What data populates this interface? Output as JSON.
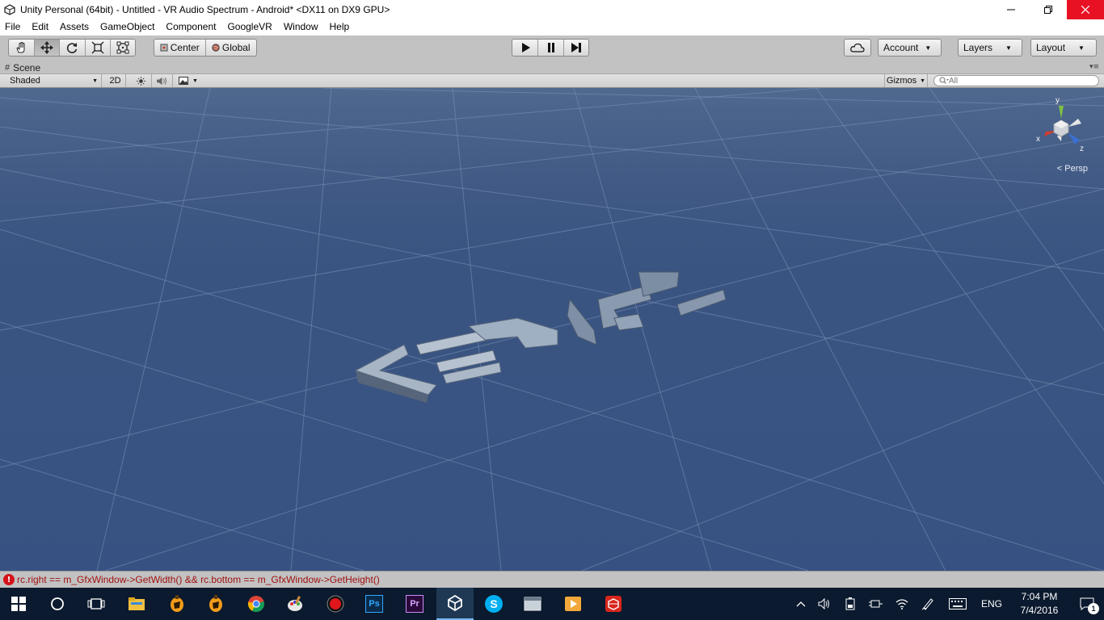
{
  "window": {
    "title": "Unity Personal (64bit) - Untitled - VR Audio Spectrum - Android* <DX11 on DX9 GPU>",
    "minimize_icon": "minimize-icon",
    "maximize_icon": "restore-icon",
    "close_icon": "close-icon"
  },
  "menubar": {
    "items": [
      "File",
      "Edit",
      "Assets",
      "GameObject",
      "Component",
      "GoogleVR",
      "Window",
      "Help"
    ]
  },
  "toolbar": {
    "transform_tools": [
      "hand-icon",
      "move-icon",
      "rotate-icon",
      "scale-icon",
      "rect-tool-icon"
    ],
    "active_tool": "move-icon",
    "pivot_center_label": "Center",
    "pivot_global_label": "Global",
    "play_icons": [
      "play-icon",
      "pause-icon",
      "step-icon"
    ],
    "cloud_icon": "cloud-icon",
    "account_label": "Account",
    "layers_label": "Layers",
    "layout_label": "Layout"
  },
  "scene_tab": {
    "label": "Scene",
    "hash": "#",
    "menu_icon": "tab-menu-icon"
  },
  "scene_controls": {
    "draw_mode": "Shaded",
    "mode_2d": "2D",
    "lighting_icon": "sun-icon",
    "audio_icon": "speaker-icon",
    "effects_icon": "image-icon",
    "gizmos_label": "Gizmos",
    "search_placeholder": "All"
  },
  "viewport": {
    "gizmo_axes": {
      "x": "x",
      "y": "y",
      "z": "z"
    },
    "projection_label": "Persp",
    "background_color": "#3b5582"
  },
  "status": {
    "error_icon": "error-icon",
    "message": "rc.right == m_GfxWindow->GetWidth() && rc.bottom == m_GfxWindow->GetHeight()"
  },
  "taskbar": {
    "apps": [
      "windows-start-icon",
      "cortana-search-icon",
      "task-view-icon",
      "file-explorer-icon",
      "fl-studio-icon",
      "fl-studio-icon",
      "chrome-icon",
      "paint-icon",
      "record-icon",
      "photoshop-icon",
      "premiere-icon",
      "unity-icon",
      "skype-icon",
      "app-window-icon",
      "media-icon",
      "sketchup-icon"
    ],
    "photoshop_label": "Ps",
    "premiere_label": "Pr",
    "skype_label": "S",
    "language": "ENG",
    "time": "7:04 PM",
    "date": "7/4/2016",
    "notification_count": "1"
  }
}
